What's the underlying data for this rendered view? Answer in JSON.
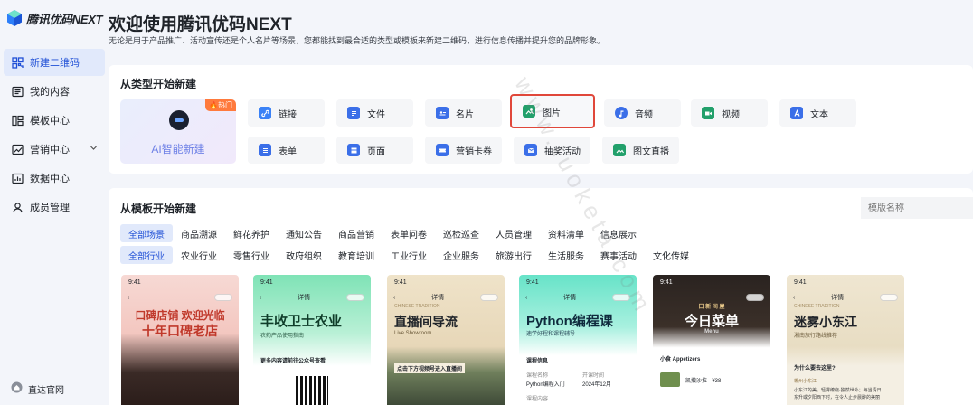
{
  "app": {
    "logo_text": "腾讯优码NEXT"
  },
  "sidebar": {
    "items": [
      {
        "label": "新建二维码",
        "icon": "qrcode-icon"
      },
      {
        "label": "我的内容",
        "icon": "content-icon"
      },
      {
        "label": "模板中心",
        "icon": "template-icon"
      },
      {
        "label": "营销中心",
        "icon": "marketing-icon"
      },
      {
        "label": "数据中心",
        "icon": "data-icon"
      },
      {
        "label": "成员管理",
        "icon": "member-icon"
      }
    ],
    "bottom_link": "直达官网"
  },
  "header": {
    "title": "欢迎使用腾讯优码NEXT",
    "subtitle": "无论是用于产品推广、活动宣传还是个人名片等场景，您都能找到最合适的类型或模板来新建二维码，进行信息传播并提升您的品牌形象。"
  },
  "create_by_type": {
    "title": "从类型开始新建",
    "ai": {
      "label": "AI智能新建",
      "badge": "🔥热门"
    },
    "types": [
      {
        "label": "链接",
        "icon": "link-icon",
        "color": "#3b82f6"
      },
      {
        "label": "文件",
        "icon": "file-icon",
        "color": "#3b6fe8"
      },
      {
        "label": "名片",
        "icon": "card-icon",
        "color": "#3b6fe8"
      },
      {
        "label": "图片",
        "icon": "image-icon",
        "color": "#22a06b"
      },
      {
        "label": "音频",
        "icon": "audio-icon",
        "color": "#3b6fe8"
      },
      {
        "label": "视频",
        "icon": "video-icon",
        "color": "#22a06b"
      },
      {
        "label": "文本",
        "icon": "text-icon",
        "color": "#3b6fe8"
      },
      {
        "label": "表单",
        "icon": "form-icon",
        "color": "#3b6fe8"
      },
      {
        "label": "页面",
        "icon": "page-icon",
        "color": "#3b6fe8"
      },
      {
        "label": "营销卡券",
        "icon": "coupon-icon",
        "color": "#3b6fe8"
      },
      {
        "label": "抽奖活动",
        "icon": "lottery-icon",
        "color": "#3b6fe8"
      },
      {
        "label": "图文直播",
        "icon": "live-icon",
        "color": "#22a06b"
      }
    ]
  },
  "create_by_template": {
    "title": "从模板开始新建",
    "search_placeholder": "模版名称",
    "scenes": [
      "全部场景",
      "商品溯源",
      "鲜花养护",
      "通知公告",
      "商品营销",
      "表单问卷",
      "巡检巡查",
      "人员管理",
      "资料清单",
      "信息展示"
    ],
    "industries": [
      "全部行业",
      "农业行业",
      "零售行业",
      "政府组织",
      "教育培训",
      "工业行业",
      "企业服务",
      "旅游出行",
      "生活服务",
      "赛事活动",
      "文化传媒"
    ],
    "templates": [
      {
        "time": "9:41",
        "nav_title": "",
        "headline": "口碑店铺 欢迎光临",
        "headline2": "十年口碑老店"
      },
      {
        "time": "9:41",
        "nav_title": "详情",
        "headline": "丰收卫士农业",
        "sub": "农药产品使用指南",
        "extra": "更多内容请前往公众号查看"
      },
      {
        "time": "9:41",
        "nav_title": "详情",
        "top": "CHINESE TRADITION",
        "headline": "直播间导流",
        "sub": "Live Showroom",
        "extra": "点击下方视频号进入直播间"
      },
      {
        "time": "9:41",
        "nav_title": "详情",
        "headline": "Python编程课",
        "sub": "速学好程和课程辅导",
        "extra": "课程信息",
        "row1a": "课程名称",
        "row1b": "开课时间",
        "row2a": "Python编程入门",
        "row2b": "2024年12月",
        "row3a": "课程内容"
      },
      {
        "time": "9:41",
        "nav_title": "",
        "top": "口 新 间 屋",
        "headline": "今日菜单",
        "sub": "Menu",
        "extra": "小食 Appetizers",
        "row1a": "凯撒沙拉 · ¥38"
      },
      {
        "time": "9:41",
        "nav_title": "详情",
        "top": "CHINESE TRADITION",
        "headline": "迷雾小东江",
        "sub": "湘南旅行路线推荐",
        "extra": "为什么要去这里?",
        "row1a": "郴州小东江",
        "row2a": "小东江的美，轻雾缭绕·独然世外；每当清日",
        "row3a": "东升或夕阳西下时，在令人止步晨醉的美丽"
      }
    ]
  },
  "watermark": "www.tuoketa.com"
}
